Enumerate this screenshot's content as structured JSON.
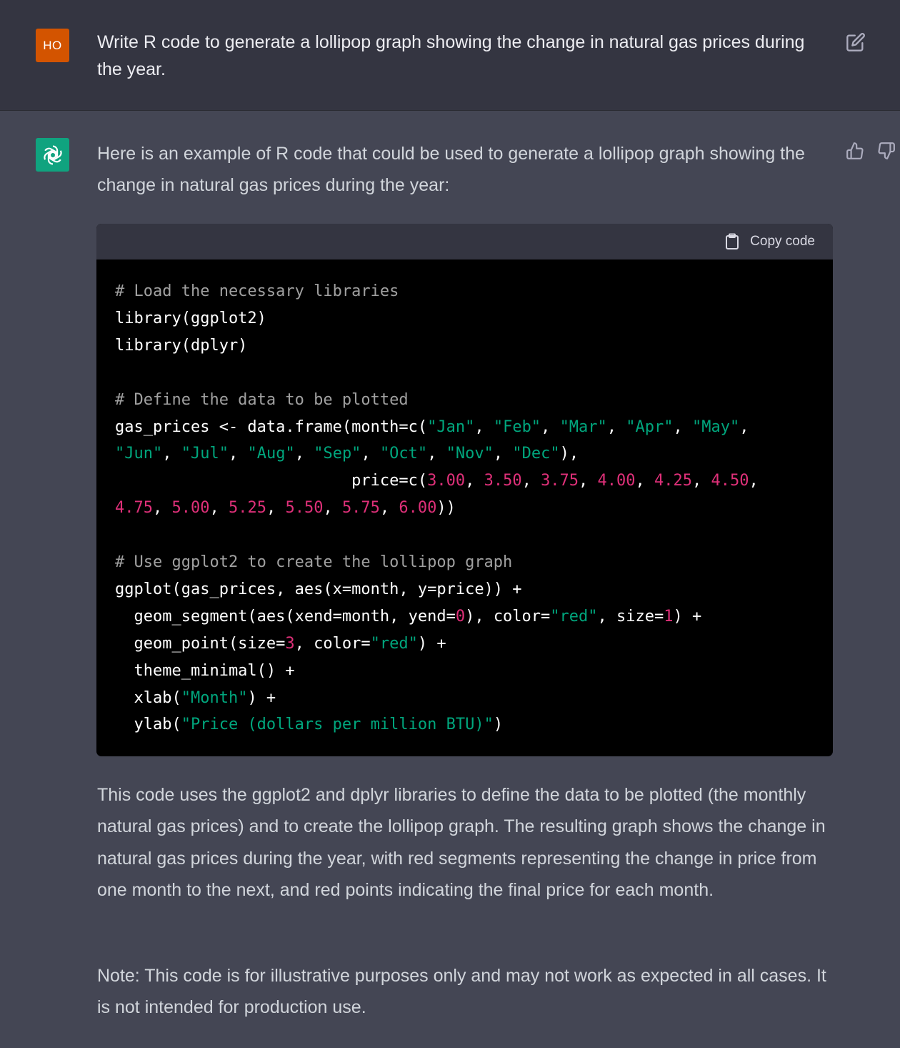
{
  "user": {
    "avatar_initials": "HO",
    "avatar_color": "#d35400",
    "message": "Write R code to generate a lollipop graph showing the change in natural gas prices during the year."
  },
  "assistant": {
    "avatar_color": "#10a37f",
    "intro": "Here is an example of R code that could be used to generate a lollipop graph showing the change in natural gas prices during the year:",
    "code_block": {
      "copy_label": "Copy code",
      "lines": [
        [
          {
            "t": "# Load the necessary libraries",
            "c": "cm"
          }
        ],
        [
          {
            "t": "library(ggplot2)",
            "c": ""
          }
        ],
        [
          {
            "t": "library(dplyr)",
            "c": ""
          }
        ],
        [],
        [
          {
            "t": "# Define the data to be plotted",
            "c": "cm"
          }
        ],
        [
          {
            "t": "gas_prices <- data.frame(month=c(",
            "c": ""
          },
          {
            "t": "\"Jan\"",
            "c": "st"
          },
          {
            "t": ", ",
            "c": ""
          },
          {
            "t": "\"Feb\"",
            "c": "st"
          },
          {
            "t": ", ",
            "c": ""
          },
          {
            "t": "\"Mar\"",
            "c": "st"
          },
          {
            "t": ", ",
            "c": ""
          },
          {
            "t": "\"Apr\"",
            "c": "st"
          },
          {
            "t": ", ",
            "c": ""
          },
          {
            "t": "\"May\"",
            "c": "st"
          },
          {
            "t": ",",
            "c": ""
          }
        ],
        [
          {
            "t": "\"Jun\"",
            "c": "st"
          },
          {
            "t": ", ",
            "c": ""
          },
          {
            "t": "\"Jul\"",
            "c": "st"
          },
          {
            "t": ", ",
            "c": ""
          },
          {
            "t": "\"Aug\"",
            "c": "st"
          },
          {
            "t": ", ",
            "c": ""
          },
          {
            "t": "\"Sep\"",
            "c": "st"
          },
          {
            "t": ", ",
            "c": ""
          },
          {
            "t": "\"Oct\"",
            "c": "st"
          },
          {
            "t": ", ",
            "c": ""
          },
          {
            "t": "\"Nov\"",
            "c": "st"
          },
          {
            "t": ", ",
            "c": ""
          },
          {
            "t": "\"Dec\"",
            "c": "st"
          },
          {
            "t": "),",
            "c": ""
          }
        ],
        [
          {
            "t": "                         price=c(",
            "c": ""
          },
          {
            "t": "3.00",
            "c": "nu"
          },
          {
            "t": ", ",
            "c": ""
          },
          {
            "t": "3.50",
            "c": "nu"
          },
          {
            "t": ", ",
            "c": ""
          },
          {
            "t": "3.75",
            "c": "nu"
          },
          {
            "t": ", ",
            "c": ""
          },
          {
            "t": "4.00",
            "c": "nu"
          },
          {
            "t": ", ",
            "c": ""
          },
          {
            "t": "4.25",
            "c": "nu"
          },
          {
            "t": ", ",
            "c": ""
          },
          {
            "t": "4.50",
            "c": "nu"
          },
          {
            "t": ",",
            "c": ""
          }
        ],
        [
          {
            "t": "4.75",
            "c": "nu"
          },
          {
            "t": ", ",
            "c": ""
          },
          {
            "t": "5.00",
            "c": "nu"
          },
          {
            "t": ", ",
            "c": ""
          },
          {
            "t": "5.25",
            "c": "nu"
          },
          {
            "t": ", ",
            "c": ""
          },
          {
            "t": "5.50",
            "c": "nu"
          },
          {
            "t": ", ",
            "c": ""
          },
          {
            "t": "5.75",
            "c": "nu"
          },
          {
            "t": ", ",
            "c": ""
          },
          {
            "t": "6.00",
            "c": "nu"
          },
          {
            "t": "))",
            "c": ""
          }
        ],
        [],
        [
          {
            "t": "# Use ggplot2 to create the lollipop graph",
            "c": "cm"
          }
        ],
        [
          {
            "t": "ggplot(gas_prices, aes(x=month, y=price)) +",
            "c": ""
          }
        ],
        [
          {
            "t": "  geom_segment(aes(xend=month, yend=",
            "c": ""
          },
          {
            "t": "0",
            "c": "nu"
          },
          {
            "t": "), color=",
            "c": ""
          },
          {
            "t": "\"red\"",
            "c": "st"
          },
          {
            "t": ", size=",
            "c": ""
          },
          {
            "t": "1",
            "c": "nu"
          },
          {
            "t": ") +",
            "c": ""
          }
        ],
        [
          {
            "t": "  geom_point(size=",
            "c": ""
          },
          {
            "t": "3",
            "c": "nu"
          },
          {
            "t": ", color=",
            "c": ""
          },
          {
            "t": "\"red\"",
            "c": "st"
          },
          {
            "t": ") +",
            "c": ""
          }
        ],
        [
          {
            "t": "  theme_minimal() +",
            "c": ""
          }
        ],
        [
          {
            "t": "  xlab(",
            "c": ""
          },
          {
            "t": "\"Month\"",
            "c": "st"
          },
          {
            "t": ") +",
            "c": ""
          }
        ],
        [
          {
            "t": "  ylab(",
            "c": ""
          },
          {
            "t": "\"Price (dollars per million BTU)\"",
            "c": "st"
          },
          {
            "t": ")",
            "c": ""
          }
        ]
      ]
    },
    "explanation": "This code uses the ggplot2 and dplyr libraries to define the data to be plotted (the monthly natural gas prices) and to create the lollipop graph. The resulting graph shows the change in natural gas prices during the year, with red segments representing the change in price from one month to the next, and red points indicating the final price for each month.",
    "note": "Note: This code is for illustrative purposes only and may not work as expected in all cases. It is not intended for production use."
  }
}
